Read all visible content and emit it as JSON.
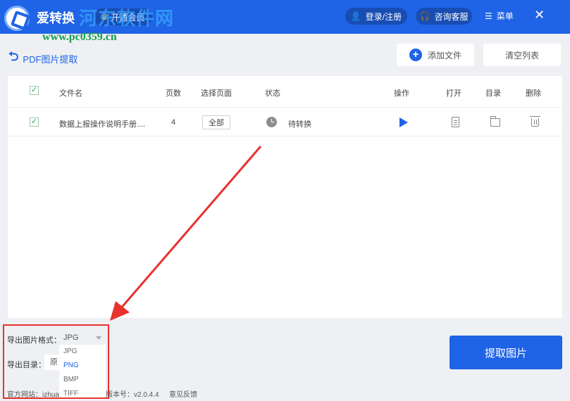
{
  "titlebar": {
    "app_name": "爱转换",
    "watermark_name": "河东软件网",
    "watermark_url": "www.pc0359.cn",
    "vip_label": "开通会员",
    "login_label": "登录/注册",
    "service_label": "咨询客服",
    "menu_label": "菜单",
    "close_glyph": "✕"
  },
  "toolbar": {
    "page_title": "PDF图片提取",
    "add_file_label": "添加文件",
    "clear_list_label": "清空列表"
  },
  "table": {
    "headers": {
      "name": "文件名",
      "pages": "页数",
      "select_pages": "选择页面",
      "status": "状态",
      "action": "操作",
      "open": "打开",
      "folder": "目录",
      "delete": "删除"
    },
    "rows": [
      {
        "checked": true,
        "name": "数据上报操作说明手册....",
        "pages": "4",
        "range": "全部",
        "status": "待转换"
      }
    ]
  },
  "options": {
    "format_label": "导出图片格式：",
    "format_value": "JPG",
    "format_options": [
      "JPG",
      "PNG",
      "BMP",
      "TIFF"
    ],
    "format_hovered": "PNG",
    "dir_label": "导出目录：",
    "dir_value": "原"
  },
  "extract_label": "提取图片",
  "footer": {
    "website": "官方网站：izhua",
    "version": "版本号：v2.0.4.4",
    "feedback": "意见反馈"
  },
  "colors": {
    "brand_blue": "#1f63e6",
    "annotation_red": "#e8322e",
    "check_green": "#2eaa4f"
  }
}
